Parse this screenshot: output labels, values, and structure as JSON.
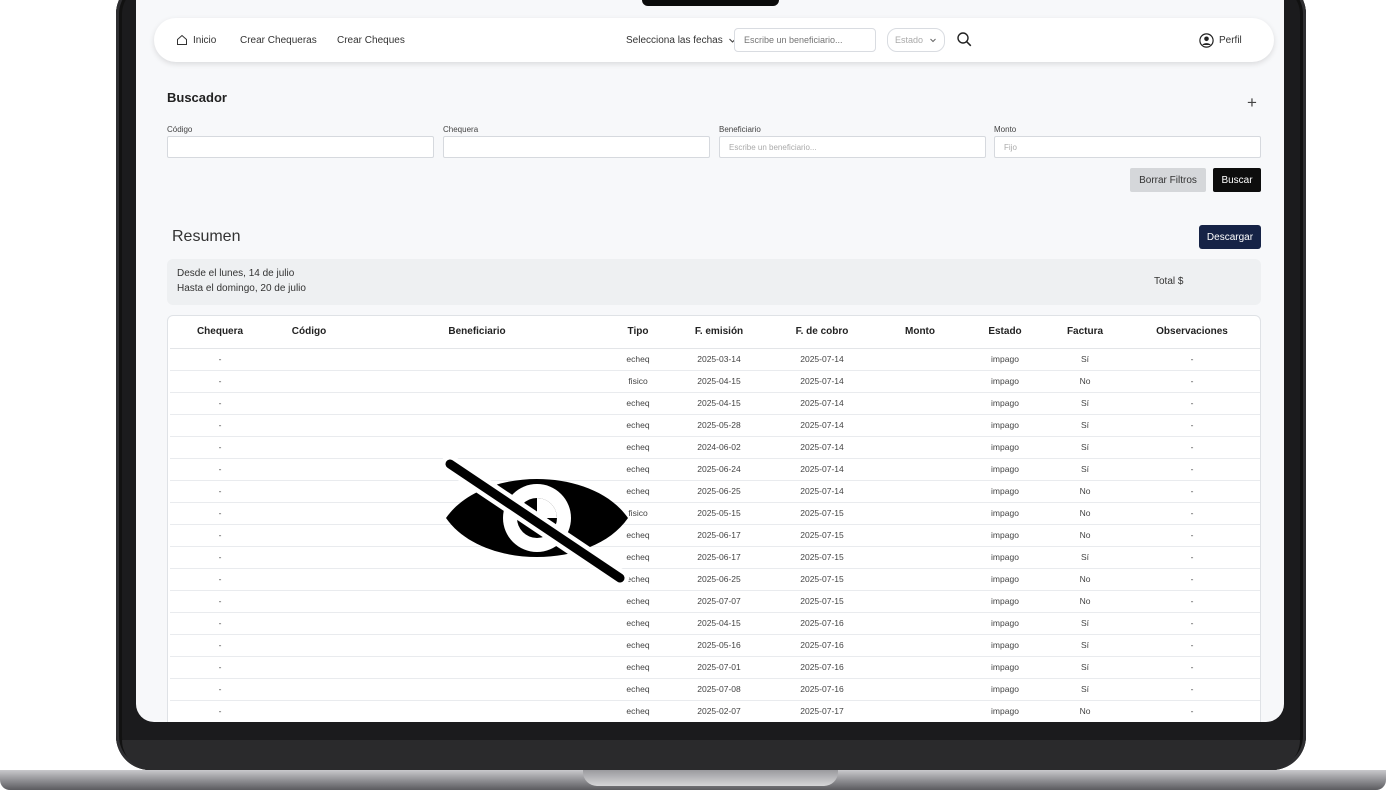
{
  "nav": {
    "home": "Inicio",
    "crear_chequeras": "Crear Chequeras",
    "crear_cheques": "Crear Cheques",
    "date_select": "Selecciona las fechas",
    "beneficiario_placeholder": "Escribe un beneficiario...",
    "estado_select": "Estado",
    "perfil": "Perfil"
  },
  "buscador": {
    "title": "Buscador",
    "fields": [
      {
        "label": "Código",
        "placeholder": ""
      },
      {
        "label": "Chequera",
        "placeholder": ""
      },
      {
        "label": "Beneficiario",
        "placeholder": "Escribe un beneficiario..."
      },
      {
        "label": "Monto",
        "placeholder": "Fijo"
      }
    ],
    "clear_button": "Borrar Filtros",
    "search_button": "Buscar"
  },
  "resumen": {
    "title": "Resumen",
    "download_button": "Descargar",
    "desde": "Desde el lunes, 14 de julio",
    "hasta": "Hasta el domingo, 20 de julio",
    "total_label": "Total $"
  },
  "table": {
    "columns": [
      "Chequera",
      "Código",
      "Beneficiario",
      "Tipo",
      "F. emisión",
      "F. de cobro",
      "Monto",
      "Estado",
      "Factura",
      "Observaciones"
    ],
    "rows": [
      {
        "chequera": "-",
        "tipo": "echeq",
        "emision": "2025-03-14",
        "cobro": "2025-07-14",
        "estado": "impago",
        "factura": "Sí",
        "obs": "-"
      },
      {
        "chequera": "-",
        "tipo": "fisico",
        "emision": "2025-04-15",
        "cobro": "2025-07-14",
        "estado": "impago",
        "factura": "No",
        "obs": "-"
      },
      {
        "chequera": "-",
        "tipo": "echeq",
        "emision": "2025-04-15",
        "cobro": "2025-07-14",
        "estado": "impago",
        "factura": "Sí",
        "obs": "-"
      },
      {
        "chequera": "-",
        "tipo": "echeq",
        "emision": "2025-05-28",
        "cobro": "2025-07-14",
        "estado": "impago",
        "factura": "Sí",
        "obs": "-"
      },
      {
        "chequera": "-",
        "tipo": "echeq",
        "emision": "2024-06-02",
        "cobro": "2025-07-14",
        "estado": "impago",
        "factura": "Sí",
        "obs": "-"
      },
      {
        "chequera": "-",
        "tipo": "echeq",
        "emision": "2025-06-24",
        "cobro": "2025-07-14",
        "estado": "impago",
        "factura": "Sí",
        "obs": "-"
      },
      {
        "chequera": "-",
        "tipo": "echeq",
        "emision": "2025-06-25",
        "cobro": "2025-07-14",
        "estado": "impago",
        "factura": "No",
        "obs": "-"
      },
      {
        "chequera": "-",
        "tipo": "fisico",
        "emision": "2025-05-15",
        "cobro": "2025-07-15",
        "estado": "impago",
        "factura": "No",
        "obs": "-"
      },
      {
        "chequera": "-",
        "tipo": "echeq",
        "emision": "2025-06-17",
        "cobro": "2025-07-15",
        "estado": "impago",
        "factura": "No",
        "obs": "-"
      },
      {
        "chequera": "-",
        "tipo": "echeq",
        "emision": "2025-06-17",
        "cobro": "2025-07-15",
        "estado": "impago",
        "factura": "Sí",
        "obs": "-"
      },
      {
        "chequera": "-",
        "tipo": "echeq",
        "emision": "2025-06-25",
        "cobro": "2025-07-15",
        "estado": "impago",
        "factura": "No",
        "obs": "-"
      },
      {
        "chequera": "-",
        "tipo": "echeq",
        "emision": "2025-07-07",
        "cobro": "2025-07-15",
        "estado": "impago",
        "factura": "No",
        "obs": "-"
      },
      {
        "chequera": "-",
        "tipo": "echeq",
        "emision": "2025-04-15",
        "cobro": "2025-07-16",
        "estado": "impago",
        "factura": "Sí",
        "obs": "-"
      },
      {
        "chequera": "-",
        "tipo": "echeq",
        "emision": "2025-05-16",
        "cobro": "2025-07-16",
        "estado": "impago",
        "factura": "Sí",
        "obs": "-"
      },
      {
        "chequera": "-",
        "tipo": "echeq",
        "emision": "2025-07-01",
        "cobro": "2025-07-16",
        "estado": "impago",
        "factura": "Sí",
        "obs": "-"
      },
      {
        "chequera": "-",
        "tipo": "echeq",
        "emision": "2025-07-08",
        "cobro": "2025-07-16",
        "estado": "impago",
        "factura": "Sí",
        "obs": "-"
      },
      {
        "chequera": "-",
        "tipo": "echeq",
        "emision": "2025-02-07",
        "cobro": "2025-07-17",
        "estado": "impago",
        "factura": "No",
        "obs": "-"
      }
    ]
  },
  "icons": {
    "home": "home-icon",
    "chevron": "chevron-down-icon",
    "search": "search-icon",
    "profile": "user-circle-icon",
    "plus": "plus-icon",
    "privacy": "eye-slash-icon"
  },
  "colors": {
    "primary_dark": "#162346",
    "button_black": "#0d0d0d",
    "button_gray": "#d5d7da"
  }
}
